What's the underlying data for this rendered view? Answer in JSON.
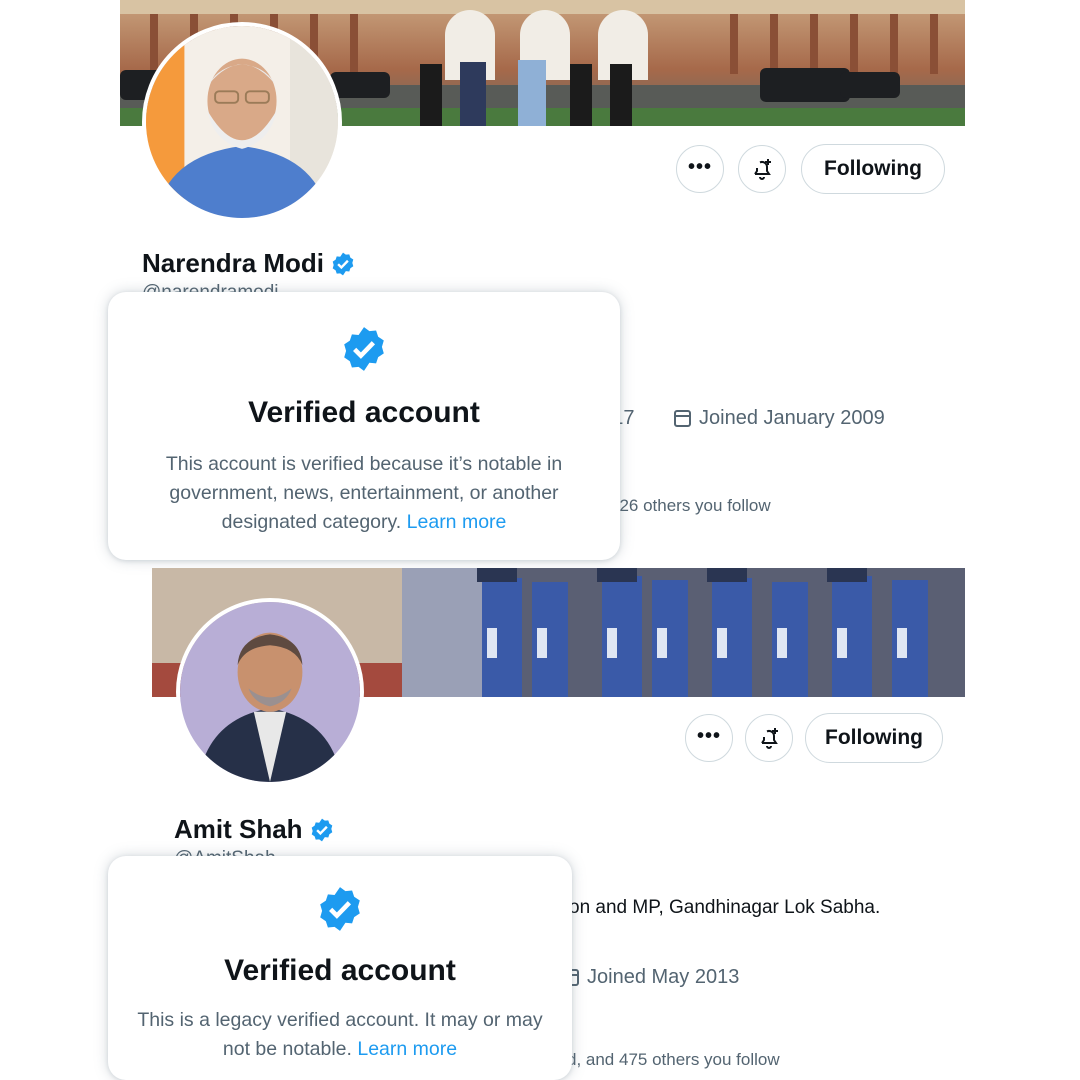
{
  "profiles": [
    {
      "name": "Narendra Modi",
      "handle": "@narendramodi",
      "birthday_fragment": "r 17",
      "joined": "Joined January 2009",
      "followed_by": "326 others you follow",
      "more_icon": "more-horizontal-icon",
      "notify_icon": "bell-plus-icon",
      "following_label": "Following"
    },
    {
      "name": "Amit Shah",
      "handle": "@AmitShah",
      "bio_fragment": "on and MP, Gandhinagar Lok Sabha.",
      "joined": "Joined May 2013",
      "followed_by": "d, and 475 others you follow",
      "more_icon": "more-horizontal-icon",
      "notify_icon": "bell-plus-icon",
      "following_label": "Following"
    }
  ],
  "popups": [
    {
      "title": "Verified account",
      "body": "This account is verified because it’s notable in government, news, entertainment, or another designated category.",
      "link": "Learn more"
    },
    {
      "title": "Verified account",
      "body": "This is a legacy verified account. It may or may not be notable.",
      "link": "Learn more"
    }
  ],
  "colors": {
    "verified_blue": "#1d9bf0",
    "secondary_text": "#536471",
    "primary_text": "#0f1419"
  }
}
